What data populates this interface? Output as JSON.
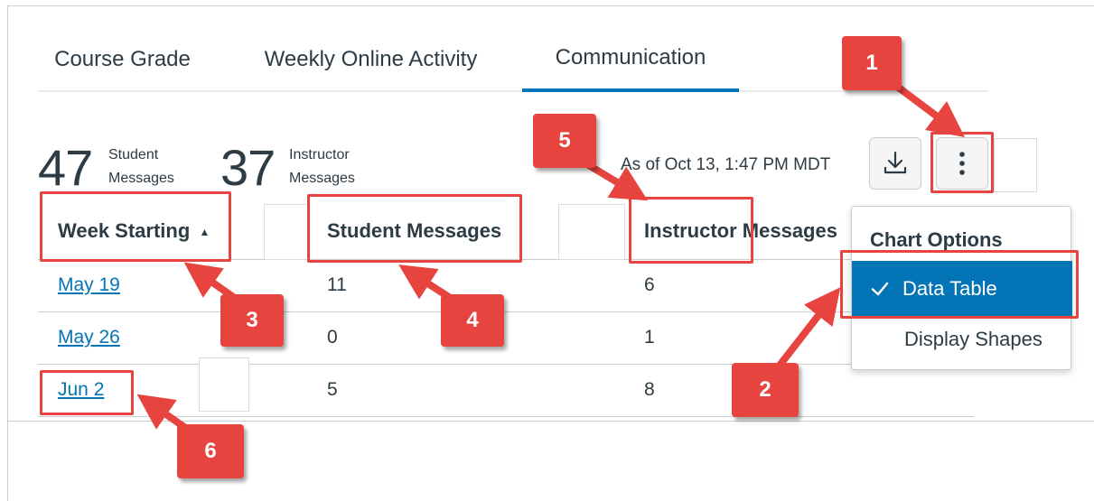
{
  "tabs": [
    {
      "label": "Course Grade"
    },
    {
      "label": "Weekly Online Activity"
    },
    {
      "label": "Communication"
    }
  ],
  "summary": {
    "student_count": "47",
    "student_label_1": "Student",
    "student_label_2": "Messages",
    "instructor_count": "37",
    "instructor_label_1": "Instructor",
    "instructor_label_2": "Messages",
    "as_of": "As of Oct 13, 1:47 PM MDT"
  },
  "table": {
    "headers": [
      "Week Starting",
      "Student Messages",
      "Instructor Messages"
    ],
    "sort_indicator": "▲",
    "rows": [
      {
        "week": "May 19",
        "student": "11",
        "instructor": "6"
      },
      {
        "week": "May 26",
        "student": "0",
        "instructor": "1"
      },
      {
        "week": "Jun 2",
        "student": "5",
        "instructor": "8"
      }
    ]
  },
  "menu": {
    "title": "Chart Options",
    "items": [
      {
        "label": "Data Table",
        "checked": true
      },
      {
        "label": "Display Shapes",
        "checked": false
      }
    ]
  },
  "icons": {
    "download": "download-icon",
    "more": "vertical-ellipsis-icon",
    "check": "checkmark-icon"
  },
  "annotations": {
    "badges": [
      "1",
      "2",
      "3",
      "4",
      "5",
      "6"
    ],
    "color": "#e8443f"
  },
  "colors": {
    "accent": "#0374b5",
    "text": "#2d3b45",
    "border": "#c7cdd1"
  }
}
